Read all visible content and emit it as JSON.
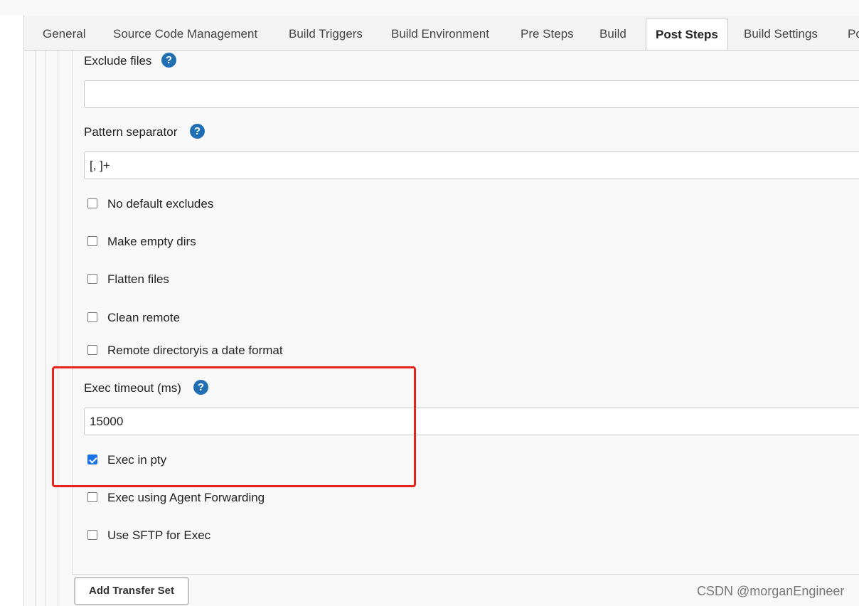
{
  "tabs": [
    {
      "label": "General"
    },
    {
      "label": "Source Code Management"
    },
    {
      "label": "Build Triggers"
    },
    {
      "label": "Build Environment"
    },
    {
      "label": "Pre Steps"
    },
    {
      "label": "Build"
    },
    {
      "label": "Post Steps"
    },
    {
      "label": "Build Settings"
    },
    {
      "label": "Po"
    }
  ],
  "active_tab": "Post Steps",
  "fields": {
    "exclude_files": {
      "label": "Exclude files",
      "value": ""
    },
    "pattern_separator": {
      "label": "Pattern separator",
      "value": "[, ]+"
    },
    "exec_timeout": {
      "label": "Exec timeout (ms)",
      "value": "15000"
    }
  },
  "checkboxes": {
    "no_default_excludes": {
      "label": "No default excludes",
      "checked": false
    },
    "make_empty_dirs": {
      "label": "Make empty dirs",
      "checked": false
    },
    "flatten_files": {
      "label": "Flatten files",
      "checked": false
    },
    "clean_remote": {
      "label": "Clean remote",
      "checked": false
    },
    "remote_directory_date": {
      "label": "Remote directoryis a date format",
      "checked": false
    },
    "exec_in_pty": {
      "label": "Exec in pty",
      "checked": true
    },
    "exec_agent_forwarding": {
      "label": "Exec using Agent Forwarding",
      "checked": false
    },
    "use_sftp": {
      "label": "Use SFTP for Exec",
      "checked": false
    }
  },
  "help_glyph": "?",
  "buttons": {
    "add_transfer_set": "Add Transfer Set"
  },
  "watermark": "CSDN @morganEngineer",
  "colors": {
    "accent": "#1a73e8",
    "help": "#1f6fb2",
    "highlight": "#e8231c"
  }
}
